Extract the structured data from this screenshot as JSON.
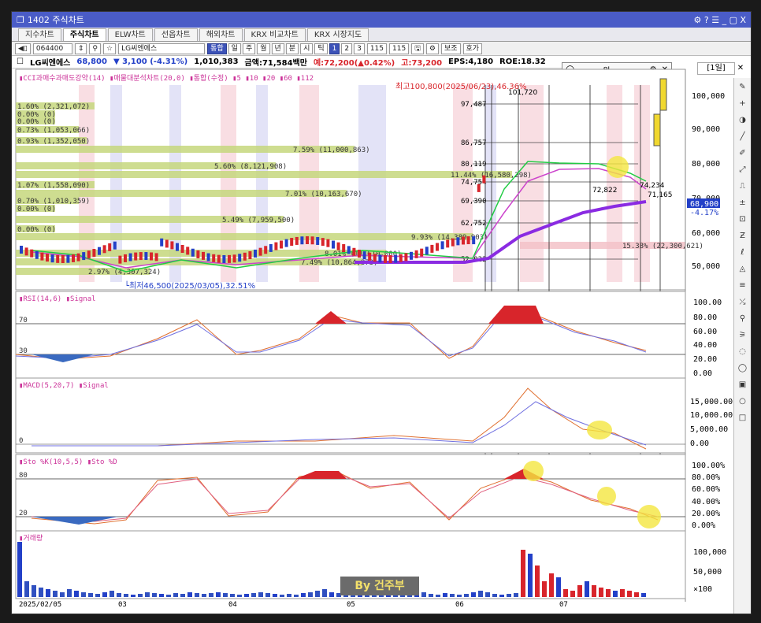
{
  "window": {
    "title": "1402 주식차트",
    "controls": "⚙ ? ☰ _ ▢ X"
  },
  "tabs": [
    "지수차트",
    "주식차트",
    "ELW차트",
    "선옵차트",
    "해외차트",
    "KRX 비교차트",
    "KRX 시장지도"
  ],
  "toolbar": {
    "code": "064400",
    "name": "LG씨엔에스",
    "buttons": [
      "통합",
      "일",
      "주",
      "월",
      "년",
      "분",
      "시",
      "틱",
      "1",
      "2",
      "3"
    ],
    "count1": "115",
    "count2": "115",
    "extra1": "보조",
    "extra2": "호가"
  },
  "info": {
    "name": "LG씨엔에스",
    "price": "68,800",
    "change": "▼ 3,100 (-4.31%)",
    "volume": "1,010,383",
    "amount": "금액:71,584백만",
    "high_label": "예:72,200(▲0.42%)",
    "hi": "고:73,200",
    "eps": "EPS:4,180",
    "roe": "ROE:18.32"
  },
  "floatbox": {
    "unit": "원"
  },
  "period_box": "[1일]",
  "legend_main": "▮CCI과매수과매도강약(14) ▮매물대분석차트(20,0) ▮통합(수정) ▮5 ▮10 ▮20 ▮60 ▮112",
  "annotations": {
    "high": "최고100,800(2025/06/23),46.36%",
    "low": "└최저46,500(2025/03/05),32.51%",
    "peak_val": "101,720",
    "val_72822": "72,822",
    "val_71165": "71,165",
    "val_74234": "74,234"
  },
  "price_levels": [
    "97,487",
    "86,757",
    "80,119",
    "74,754",
    "69,390",
    "62,752",
    "52,022"
  ],
  "price_axis": [
    "100,000",
    "90,000",
    "80,000",
    "70,000",
    "60,000",
    "50,000"
  ],
  "current_price": "68,900",
  "current_pct": "-4.17%",
  "volume_profile": [
    {
      "label": "1.60% (2,321,072)"
    },
    {
      "label": "0.00% (0)"
    },
    {
      "label": "0.00% (0)"
    },
    {
      "label": "0.73% (1,053,066)"
    },
    {
      "label": "0.93% (1,352,050)"
    },
    {
      "label": "7.59% (11,000,863)"
    },
    {
      "label": "5.60% (8,121,908)"
    },
    {
      "label": "11.44% (16,580,298)"
    },
    {
      "label": "1.07% (1,558,090)"
    },
    {
      "label": "7.01% (10,163,670)"
    },
    {
      "label": "0.70% (1,010,359)"
    },
    {
      "label": "0.00% (0)"
    },
    {
      "label": "5.49% (7,959,500)"
    },
    {
      "label": "0.00% (0)"
    },
    {
      "label": "9.93% (14,389,903)"
    },
    {
      "label": "8.01% (11,610,000)"
    },
    {
      "label": "7.49% (10,864,873)"
    },
    {
      "label": "2.97% (4,307,324)"
    },
    {
      "label": "15.38% (22,300,621)"
    }
  ],
  "rsi": {
    "legend": "▮RSI(14,6) ▮Signal",
    "levels": [
      "70",
      "30"
    ],
    "axis": [
      "100.00",
      "80.00",
      "60.00",
      "40.00",
      "20.00",
      "0.00"
    ]
  },
  "macd": {
    "legend": "▮MACD(5,20,7) ▮Signal",
    "zero": "0",
    "axis": [
      "15,000.00",
      "10,000.00",
      "5,000.00",
      "0.00"
    ]
  },
  "sto": {
    "legend": "▮Sto %K(10,5,5) ▮Sto %D",
    "levels": [
      "80",
      "20"
    ],
    "axis": [
      "100.00%",
      "80.00%",
      "60.00%",
      "40.00%",
      "20.00%",
      "0.00%"
    ]
  },
  "vol": {
    "legend": "▮거래량",
    "axis": [
      "100,000",
      "50,000",
      "×100"
    ]
  },
  "dates": [
    "2025/02/05",
    "03",
    "04",
    "05",
    "06",
    "07"
  ],
  "watermark": "By 건주부",
  "colors": {
    "up": "#d8252b",
    "down": "#2340c8",
    "title": "#4a5cc7",
    "profile": "#c6d77d",
    "ma5": "#ff8800",
    "ma10": "#22cc44",
    "ma20": "#cc44cc",
    "ma60": "#8a2be2"
  }
}
